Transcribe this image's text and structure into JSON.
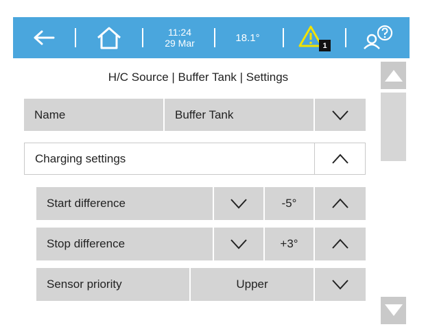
{
  "topbar": {
    "time": "11:24",
    "date": "29 Mar",
    "temperature": "18.1°",
    "alert_count": "1",
    "icons": {
      "back": "arrow-left-icon",
      "home": "home-icon",
      "alert": "warning-triangle-icon",
      "help": "user-help-icon"
    }
  },
  "breadcrumb": "H/C Source | Buffer Tank | Settings",
  "name_row": {
    "label": "Name",
    "value": "Buffer Tank"
  },
  "charging_section": {
    "label": "Charging settings"
  },
  "start_difference": {
    "label": "Start difference",
    "value": "-5°"
  },
  "stop_difference": {
    "label": "Stop difference",
    "value": "+3°"
  },
  "sensor_priority": {
    "label": "Sensor priority",
    "value": "Upper"
  },
  "colors": {
    "topbar": "#4aa6dd",
    "row_background": "#d4d4d4",
    "warning": "#f2e200",
    "scroll_button": "#c9c9c9"
  }
}
